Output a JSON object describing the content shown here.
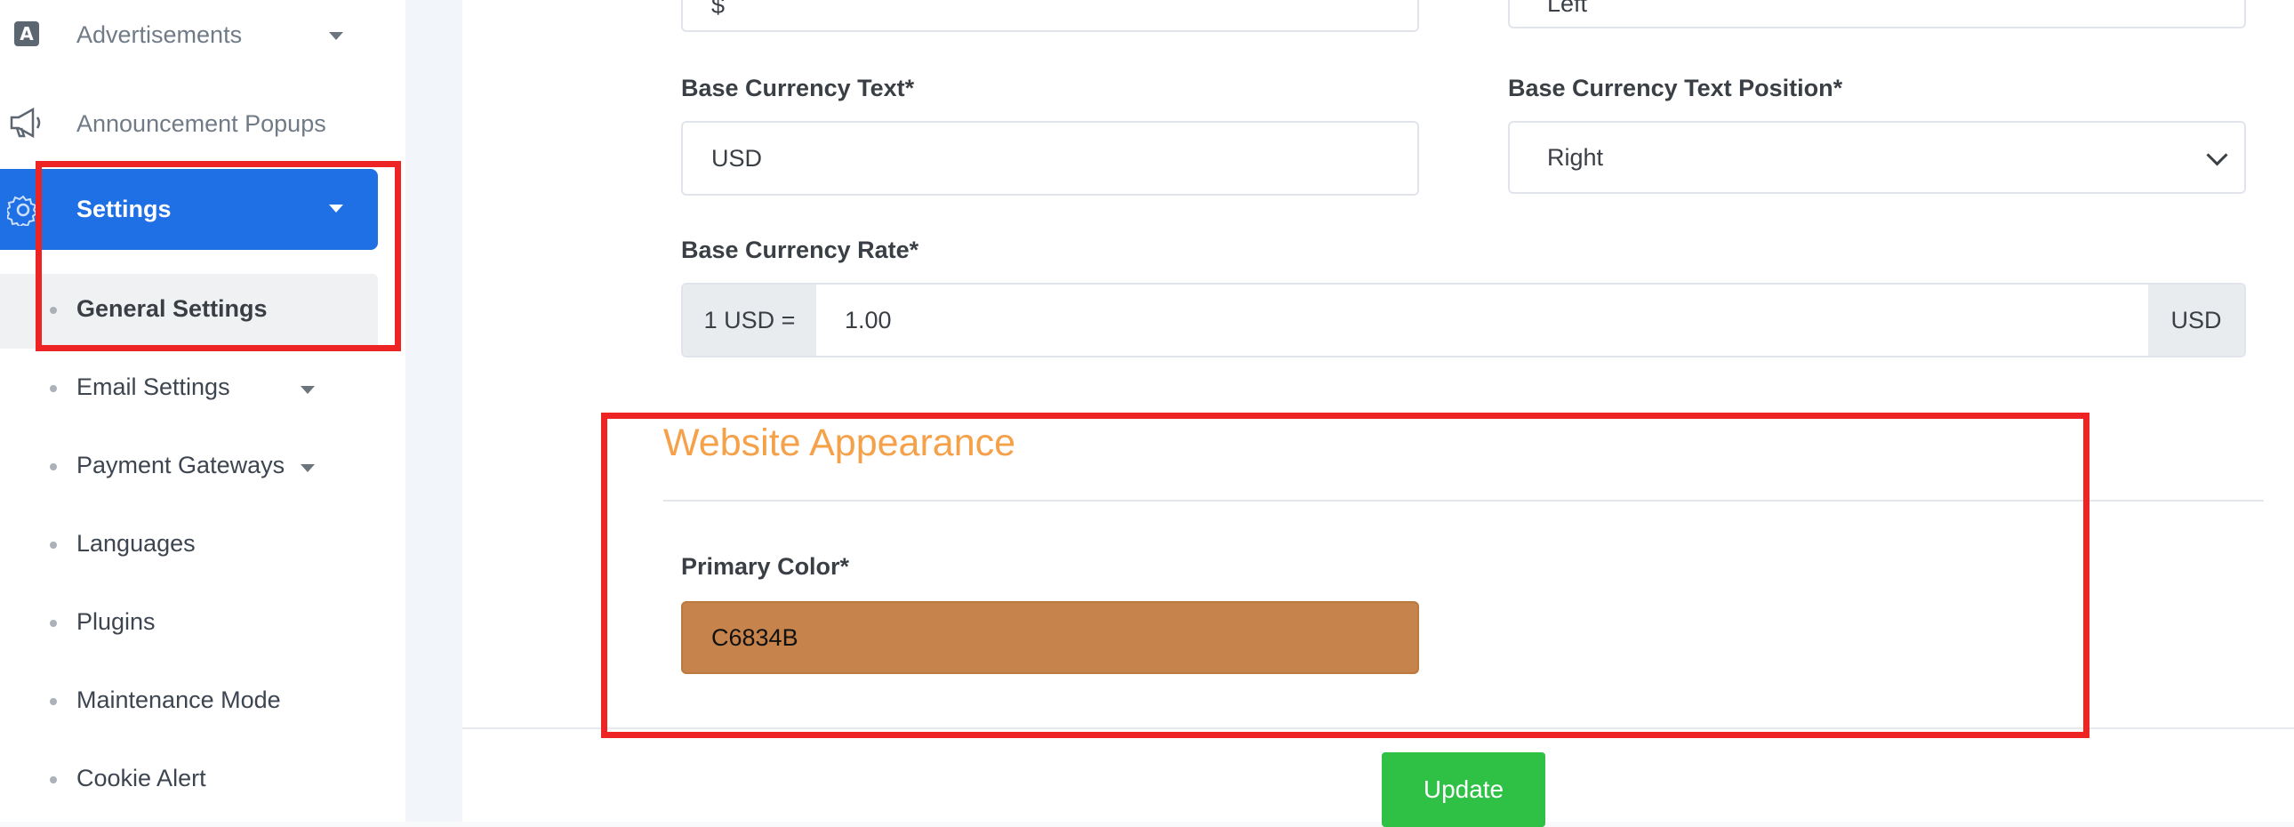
{
  "sidebar": {
    "items": [
      {
        "label": "Advertisements",
        "icon": "ad-letter-icon"
      },
      {
        "label": "Announcement Popups",
        "icon": "megaphone-icon"
      },
      {
        "label": "Settings",
        "icon": "gear-icon"
      }
    ],
    "settings_submenu": [
      {
        "label": "General Settings"
      },
      {
        "label": "Email Settings"
      },
      {
        "label": "Payment Gateways"
      },
      {
        "label": "Languages"
      },
      {
        "label": "Plugins"
      },
      {
        "label": "Maintenance Mode"
      },
      {
        "label": "Cookie Alert"
      }
    ]
  },
  "form": {
    "prev_symbol_value": "$",
    "prev_position_value": "Left",
    "base_currency_text": {
      "label": "Base Currency Text*",
      "value": "USD"
    },
    "base_currency_text_position": {
      "label": "Base Currency Text Position*",
      "value": "Right"
    },
    "base_currency_rate": {
      "label": "Base Currency Rate*",
      "prefix": "1 USD =",
      "value": "1.00",
      "suffix": "USD"
    },
    "appearance": {
      "title": "Website Appearance",
      "primary_color": {
        "label": "Primary Color*",
        "value": "C6834B"
      }
    },
    "update_label": "Update"
  },
  "colors": {
    "accent": "#1f6fe5",
    "section_title": "#f5a14a",
    "primary_color_swatch": "#C6834B",
    "update_button": "#2fc146",
    "highlight": "#ee2424"
  }
}
